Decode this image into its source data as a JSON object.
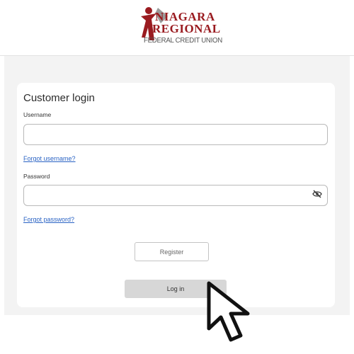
{
  "header": {
    "logo": {
      "line1": "NIAGARA",
      "line2": "REGIONAL",
      "line3": "FEDERAL CREDIT UNION",
      "mark_icon": "person-star-logo-icon",
      "brand_color": "#9a1b20"
    }
  },
  "login": {
    "title": "Customer login",
    "username_label": "Username",
    "username_value": "",
    "forgot_username": "Forgot username?",
    "password_label": "Password",
    "password_value": "",
    "password_toggle_icon": "eye-slash-icon",
    "forgot_password": "Forgot password?",
    "register_label": "Register",
    "login_label": "Log in"
  },
  "colors": {
    "link": "#2a63c4",
    "page_background": "#f3f3f3",
    "login_button": "#d7d7d7"
  },
  "overlay": {
    "cursor_icon": "arrow-cursor-icon"
  }
}
